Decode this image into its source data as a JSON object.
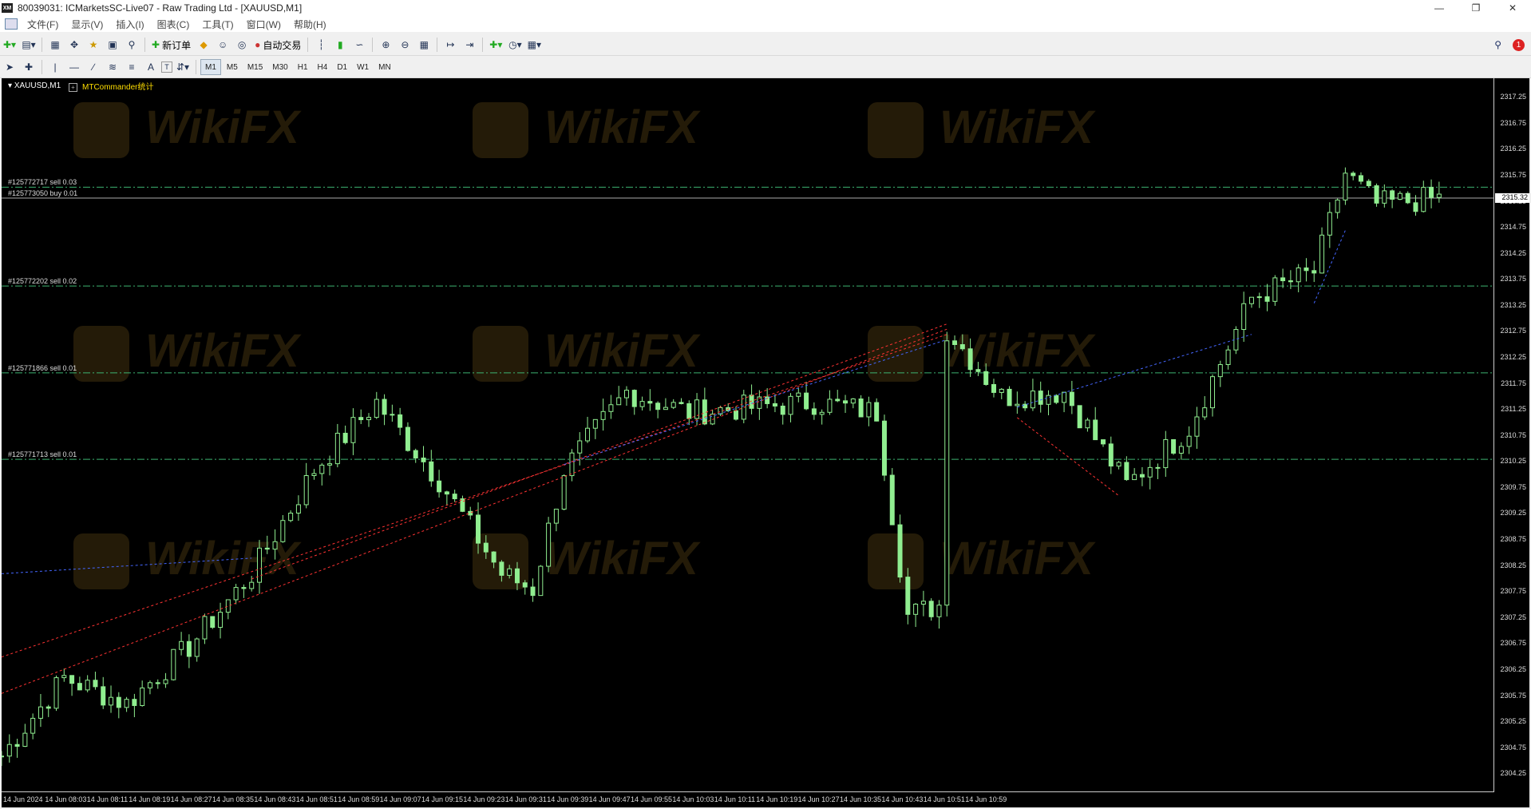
{
  "window": {
    "title": "80039031: ICMarketsSC-Live07 - Raw Trading Ltd - [XAUUSD,M1]",
    "logo": "XM"
  },
  "menu": [
    "文件(F)",
    "显示(V)",
    "插入(I)",
    "图表(C)",
    "工具(T)",
    "窗口(W)",
    "帮助(H)"
  ],
  "toolbar": {
    "new_order": "新订单",
    "auto_trading": "自动交易",
    "notification_count": "1",
    "text_tool": "A",
    "label_tool": "T"
  },
  "timeframes": [
    "M1",
    "M5",
    "M15",
    "M30",
    "H1",
    "H4",
    "D1",
    "W1",
    "MN"
  ],
  "active_timeframe": "M1",
  "chart": {
    "symbol_tab": "XAUUSD,M1",
    "indicator": "MTCommander统计",
    "current_price": "2315.32",
    "price_ticks": [
      "2317.25",
      "2316.75",
      "2316.25",
      "2315.75",
      "2315.25",
      "2314.75",
      "2314.25",
      "2313.75",
      "2313.25",
      "2312.75",
      "2312.25",
      "2311.75",
      "2311.25",
      "2310.75",
      "2310.25",
      "2309.75",
      "2309.25",
      "2308.75",
      "2308.25",
      "2307.75",
      "2307.25",
      "2306.75",
      "2306.25",
      "2305.75",
      "2305.25",
      "2304.75",
      "2304.25"
    ],
    "time_ticks": [
      "14 Jun 2024",
      "14 Jun 08:03",
      "14 Jun 08:11",
      "14 Jun 08:19",
      "14 Jun 08:27",
      "14 Jun 08:35",
      "14 Jun 08:43",
      "14 Jun 08:51",
      "14 Jun 08:59",
      "14 Jun 09:07",
      "14 Jun 09:15",
      "14 Jun 09:23",
      "14 Jun 09:31",
      "14 Jun 09:39",
      "14 Jun 09:47",
      "14 Jun 09:55",
      "14 Jun 10:03",
      "14 Jun 10:11",
      "14 Jun 10:19",
      "14 Jun 10:27",
      "14 Jun 10:35",
      "14 Jun 10:43",
      "14 Jun 10:51",
      "14 Jun 10:59"
    ],
    "orders": [
      {
        "label": "#125772717 sell 0.03",
        "price": 2315.53
      },
      {
        "label": "#125773050 buy 0.01",
        "price": 2315.32
      },
      {
        "label": "#125772202 sell 0.02",
        "price": 2313.63
      },
      {
        "label": "#125771866 sell 0.01",
        "price": 2311.96
      },
      {
        "label": "#125771713 sell 0.01",
        "price": 2310.3
      }
    ],
    "watermark": "WikiFX",
    "colors": {
      "background": "#000000",
      "candle": "#90ee90",
      "grid_line": "#3cb371",
      "sell_line": "#ff3333",
      "buy_line": "#4466ff"
    }
  },
  "chart_data": {
    "type": "candlestick",
    "symbol": "XAUUSD",
    "timeframe": "M1",
    "ylim": [
      2304.1,
      2317.5
    ],
    "x_start": "14 Jun 2024 07:55",
    "x_end": "14 Jun 2024 11:03",
    "ohlc_anchor_closes": [
      [
        "07:55",
        2304.6
      ],
      [
        "08:03",
        2306.1
      ],
      [
        "08:11",
        2305.6
      ],
      [
        "08:19",
        2306.7
      ],
      [
        "08:27",
        2308.1
      ],
      [
        "08:35",
        2310.1
      ],
      [
        "08:43",
        2311.4
      ],
      [
        "08:51",
        2309.9
      ],
      [
        "08:59",
        2308.1
      ],
      [
        "09:03",
        2307.8
      ],
      [
        "09:07",
        2310.1
      ],
      [
        "09:15",
        2311.6
      ],
      [
        "09:23",
        2311.2
      ],
      [
        "09:31",
        2311.3
      ],
      [
        "09:39",
        2311.4
      ],
      [
        "09:47",
        2311.2
      ],
      [
        "09:51",
        2307.3
      ],
      [
        "09:55",
        2307.5
      ],
      [
        "09:56",
        2312.8
      ],
      [
        "10:03",
        2311.5
      ],
      [
        "10:11",
        2311.6
      ],
      [
        "10:19",
        2309.8
      ],
      [
        "10:27",
        2310.9
      ],
      [
        "10:35",
        2313.4
      ],
      [
        "10:43",
        2313.9
      ],
      [
        "10:47",
        2315.8
      ],
      [
        "10:51",
        2315.2
      ],
      [
        "10:59",
        2315.32
      ]
    ]
  }
}
